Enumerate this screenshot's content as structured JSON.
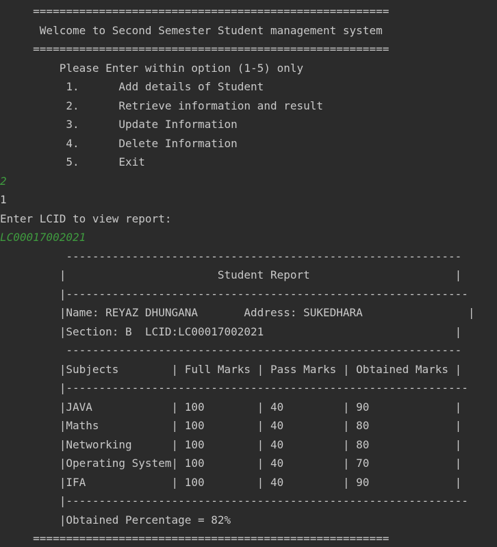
{
  "console": {
    "lines": [
      {
        "text": "     ======================================================",
        "kind": "output"
      },
      {
        "text": "      Welcome to Second Semester Student management system",
        "kind": "output"
      },
      {
        "text": "     ======================================================",
        "kind": "output"
      },
      {
        "text": "         Please Enter within option (1-5) only",
        "kind": "output"
      },
      {
        "text": "          1.      Add details of Student",
        "kind": "output"
      },
      {
        "text": "          2.      Retrieve information and result",
        "kind": "output"
      },
      {
        "text": "          3.      Update Information",
        "kind": "output"
      },
      {
        "text": "          4.      Delete Information",
        "kind": "output"
      },
      {
        "text": "          5.      Exit",
        "kind": "output"
      },
      {
        "text": "2",
        "kind": "input"
      },
      {
        "text": "1",
        "kind": "output"
      },
      {
        "text": "Enter LCID to view report:",
        "kind": "output"
      },
      {
        "text": "LC00017002021",
        "kind": "input"
      },
      {
        "text": "          ------------------------------------------------------------",
        "kind": "output"
      },
      {
        "text": "         |                       Student Report                      |",
        "kind": "output"
      },
      {
        "text": "         |-------------------------------------------------------------",
        "kind": "output"
      },
      {
        "text": "         |Name: REYAZ DHUNGANA       Address: SUKEDHARA                |",
        "kind": "output"
      },
      {
        "text": "         |Section: B  LCID:LC00017002021                             |",
        "kind": "output"
      },
      {
        "text": "          ------------------------------------------------------------",
        "kind": "output"
      },
      {
        "text": "         |Subjects        | Full Marks | Pass Marks | Obtained Marks |",
        "kind": "output"
      },
      {
        "text": "         |-------------------------------------------------------------",
        "kind": "output"
      },
      {
        "text": "         |JAVA            | 100        | 40         | 90             |",
        "kind": "output"
      },
      {
        "text": "         |Maths           | 100        | 40         | 80             |",
        "kind": "output"
      },
      {
        "text": "         |Networking      | 100        | 40         | 80             |",
        "kind": "output"
      },
      {
        "text": "         |Operating System| 100        | 40         | 70             |",
        "kind": "output"
      },
      {
        "text": "         |IFA             | 100        | 40         | 90             |",
        "kind": "output"
      },
      {
        "text": "         |-------------------------------------------------------------",
        "kind": "output"
      },
      {
        "text": "         |Obtained Percentage = 82%",
        "kind": "output"
      },
      {
        "text": "     ======================================================",
        "kind": "output"
      }
    ]
  }
}
